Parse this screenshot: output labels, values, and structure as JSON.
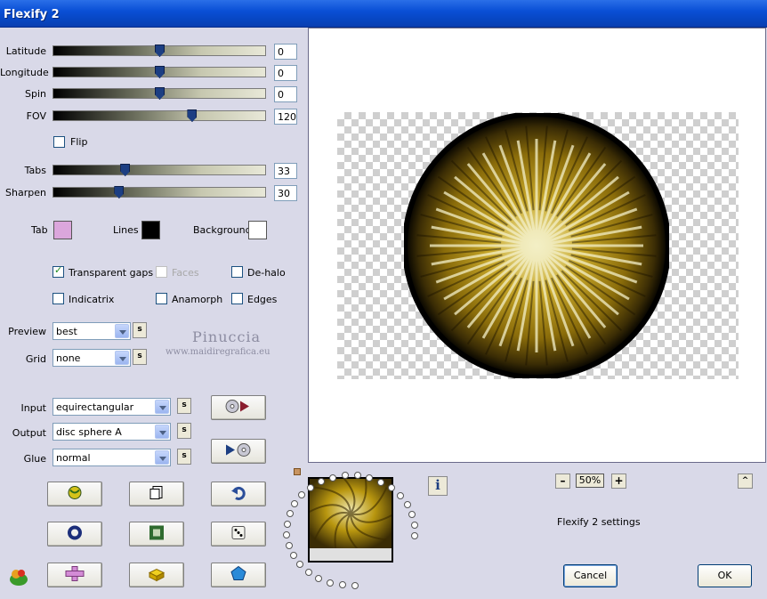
{
  "window": {
    "title": "Flexify 2"
  },
  "sliders": [
    {
      "label": "Latitude",
      "value": "0",
      "fraction": 0.5
    },
    {
      "label": "Longitude",
      "value": "0",
      "fraction": 0.5
    },
    {
      "label": "Spin",
      "value": "0",
      "fraction": 0.5
    },
    {
      "label": "FOV",
      "value": "120",
      "fraction": 0.66
    },
    {
      "label": "Tabs",
      "value": "33",
      "fraction": 0.33
    },
    {
      "label": "Sharpen",
      "value": "30",
      "fraction": 0.3
    }
  ],
  "flip": {
    "label": "Flip",
    "checked": false
  },
  "colors": {
    "tab_label": "Tab",
    "tab_color": "#dba6dc",
    "lines_label": "Lines",
    "lines_color": "#000000",
    "background_label": "Background",
    "background_color": "#ffffff"
  },
  "options": {
    "transparent_gaps": {
      "label": "Transparent gaps",
      "checked": true
    },
    "faces": {
      "label": "Faces",
      "checked": false,
      "disabled": true
    },
    "dehalo": {
      "label": "De-halo",
      "checked": false
    },
    "indicatrix": {
      "label": "Indicatrix",
      "checked": false
    },
    "anamorph": {
      "label": "Anamorph",
      "checked": false
    },
    "edges": {
      "label": "Edges",
      "checked": false
    }
  },
  "dropdowns": {
    "preview": {
      "label": "Preview",
      "value": "best"
    },
    "grid": {
      "label": "Grid",
      "value": "none"
    },
    "input": {
      "label": "Input",
      "value": "equirectangular"
    },
    "output": {
      "label": "Output",
      "value": "disc sphere A"
    },
    "glue": {
      "label": "Glue",
      "value": "normal"
    },
    "s_label": "s"
  },
  "watermark": {
    "line1": "Pinuccia",
    "line2": "www.maidiregrafica.eu"
  },
  "right": {
    "zoom": "50%",
    "settings_label": "Flexify 2 settings",
    "cancel": "Cancel",
    "ok": "OK"
  },
  "icons": {
    "info": "info-icon",
    "zoom_out": "minus-icon",
    "zoom_in": "plus-icon",
    "collapse": "caret-up-icon"
  }
}
